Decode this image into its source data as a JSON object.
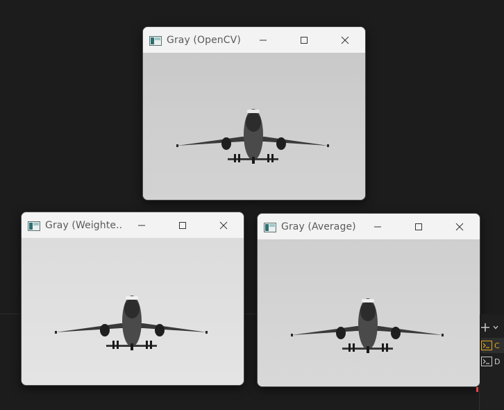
{
  "windows": [
    {
      "title": "Gray (OpenCV)"
    },
    {
      "title": "Gray (Weighte..."
    },
    {
      "title": "Gray (Average)"
    }
  ],
  "terminal_panel": {
    "items": [
      {
        "label": "C"
      },
      {
        "label": "D"
      }
    ]
  }
}
